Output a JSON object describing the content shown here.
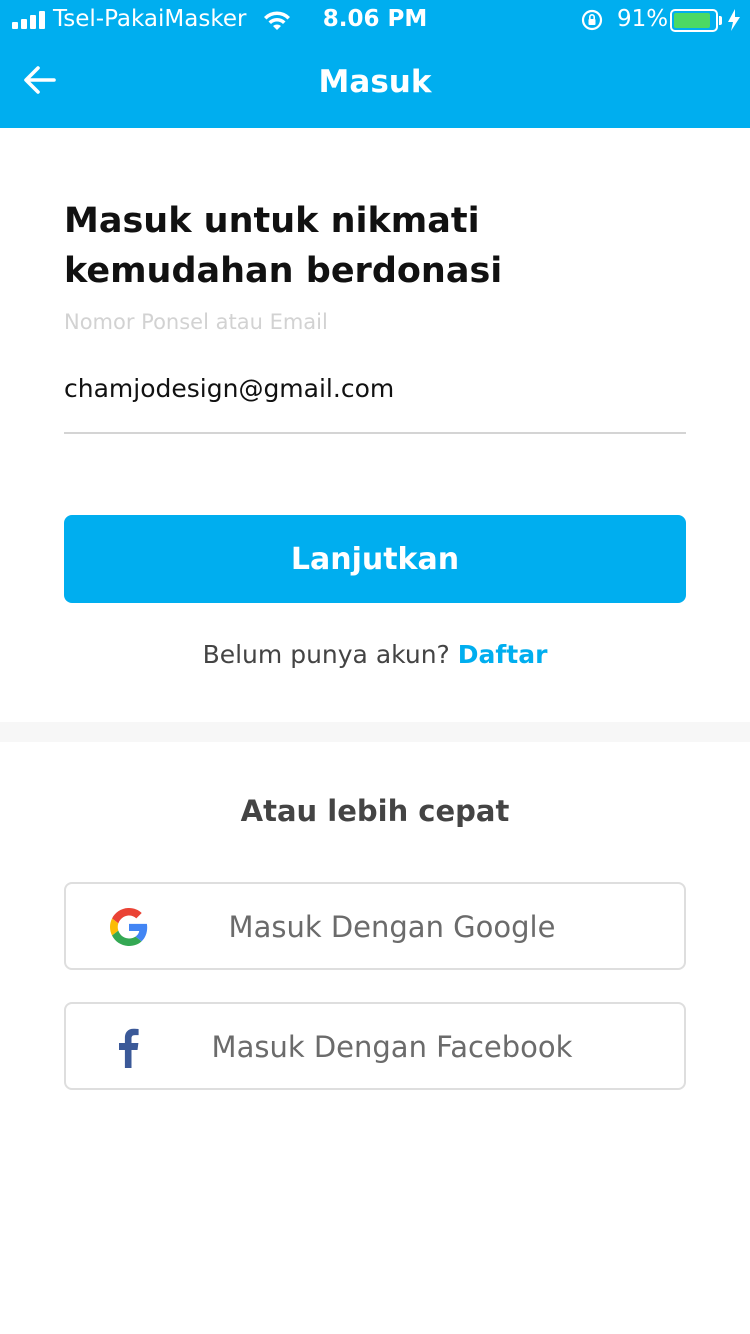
{
  "status_bar": {
    "carrier": "Tsel-PakaiMasker",
    "time": "8.06 PM",
    "battery_percent": "91%",
    "battery_level": 0.91
  },
  "nav": {
    "title": "Masuk",
    "back_icon": "arrow-left-icon"
  },
  "login": {
    "heading": "Masuk untuk nikmati kemudahan berdonasi",
    "field_label": "Nomor Ponsel atau Email",
    "email_value": "chamjodesign@gmail.com",
    "continue_label": "Lanjutkan",
    "no_account_text": "Belum punya akun?",
    "signup_link": "Daftar"
  },
  "alternative": {
    "title": "Atau lebih cepat",
    "google_label": "Masuk Dengan Google",
    "facebook_label": "Masuk Dengan Facebook"
  },
  "colors": {
    "primary": "#00AEEF",
    "facebook": "#3b5998",
    "battery": "#4CD964"
  }
}
